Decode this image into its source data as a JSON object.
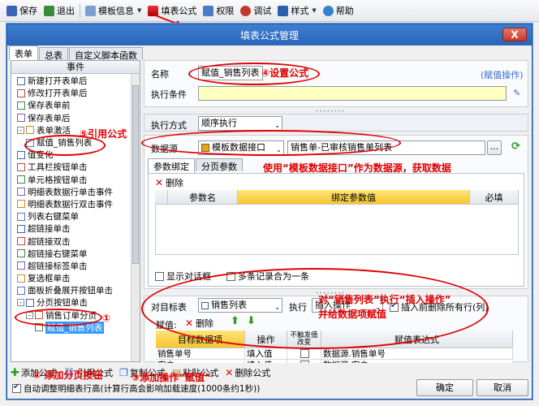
{
  "toolbar": {
    "save": "保存",
    "exit": "退出",
    "template_info": "模板信息",
    "fill_formula": "填表公式",
    "permission": "权限",
    "debug": "调试",
    "style": "样式",
    "help": "帮助"
  },
  "dialog": {
    "title": "填表公式管理",
    "close": "X",
    "tabs": [
      "表单",
      "总表",
      "自定义脚本函数"
    ],
    "events_header": "事件",
    "tree": [
      {
        "label": "新建打开表单后",
        "indent": 1
      },
      {
        "label": "修改打开表单后",
        "indent": 1
      },
      {
        "label": "保存表单前",
        "indent": 1
      },
      {
        "label": "保存表单后",
        "indent": 1
      },
      {
        "label": "表单激活",
        "indent": 1,
        "expand": "-"
      },
      {
        "label": "赋值_销售列表",
        "indent": 2
      },
      {
        "label": "值变化",
        "indent": 1
      },
      {
        "label": "工具栏按钮单击",
        "indent": 1
      },
      {
        "label": "单元格按钮单击",
        "indent": 1
      },
      {
        "label": "明细表数据行单击事件",
        "indent": 1
      },
      {
        "label": "明细表数据行双击事件",
        "indent": 1
      },
      {
        "label": "列表右键菜单",
        "indent": 1
      },
      {
        "label": "超链接单击",
        "indent": 1
      },
      {
        "label": "超链接双击",
        "indent": 1
      },
      {
        "label": "超链接右键菜单",
        "indent": 1
      },
      {
        "label": "超链接标签单击",
        "indent": 1
      },
      {
        "label": "复选框单击",
        "indent": 1
      },
      {
        "label": "面板折叠展开按钮单击",
        "indent": 1
      },
      {
        "label": "分页按钮单击",
        "indent": 1,
        "expand": "-"
      },
      {
        "label": "销售订单分页",
        "indent": 2,
        "expand": "-"
      },
      {
        "label": "赋值_销售列表",
        "indent": 3,
        "selected": true
      }
    ]
  },
  "form": {
    "name_label": "名称",
    "name_value": "赋值_销售列表",
    "op_link": "(赋值操作)",
    "condition_label": "执行条件",
    "exec_mode_label": "执行方式",
    "exec_mode_value": "顺序执行",
    "datasource_label": "数据源",
    "datasource_type": "模板数据接口",
    "datasource_value": "销售单-已审核销售单列表",
    "ellipsis": "...",
    "sub_tabs": [
      "参数绑定",
      "分页参数"
    ],
    "delete": "删除",
    "param_cols": [
      "参数名",
      "绑定参数值",
      "必填"
    ],
    "show_dialog": "显示对话框",
    "merge_records": "多条记录合为一条",
    "target_label": "对目标表",
    "target_value": "销售列表",
    "exec_label": "执行",
    "exec_value": "插入操作",
    "clear_label": "插入前删除所有行(列)",
    "assign_label": "赋值:",
    "assign_delete": "删除",
    "assign_cols": [
      "目标数据项",
      "操作",
      "不触发值改变",
      "赋值表达式"
    ],
    "assign_rows": [
      {
        "target": "销售单号",
        "op": "填入值",
        "expr": "数据源.销售单号"
      },
      {
        "target": "客户",
        "op": "填入值",
        "expr": "数据源.客户"
      }
    ]
  },
  "bottom": {
    "add": "添加公式",
    "ref": "引用公式",
    "copy": "复制公式",
    "paste": "粘贴公式",
    "del": "删除公式",
    "auto_adjust": "自动调整明细表行高(计算行高会影响加载速度(1000条约1秒))",
    "ok": "确定",
    "cancel": "取消"
  },
  "annotations": {
    "set_formula": "④设置公式",
    "ref_formula": "⑤引用公式",
    "datasource_note": "使用“模板数据接口”作为数据源，获取数据",
    "insert_note_1": "对“销售列表”执行“插入操作”",
    "insert_note_2": "并给数据项赋值",
    "step1": "①",
    "step2": "② 添加分页按钮",
    "step3": "③添加操作“赋值”"
  },
  "colors": {
    "annotation": "#e00000",
    "accent": "#2a65b8",
    "highlight": "#ffffc0"
  }
}
